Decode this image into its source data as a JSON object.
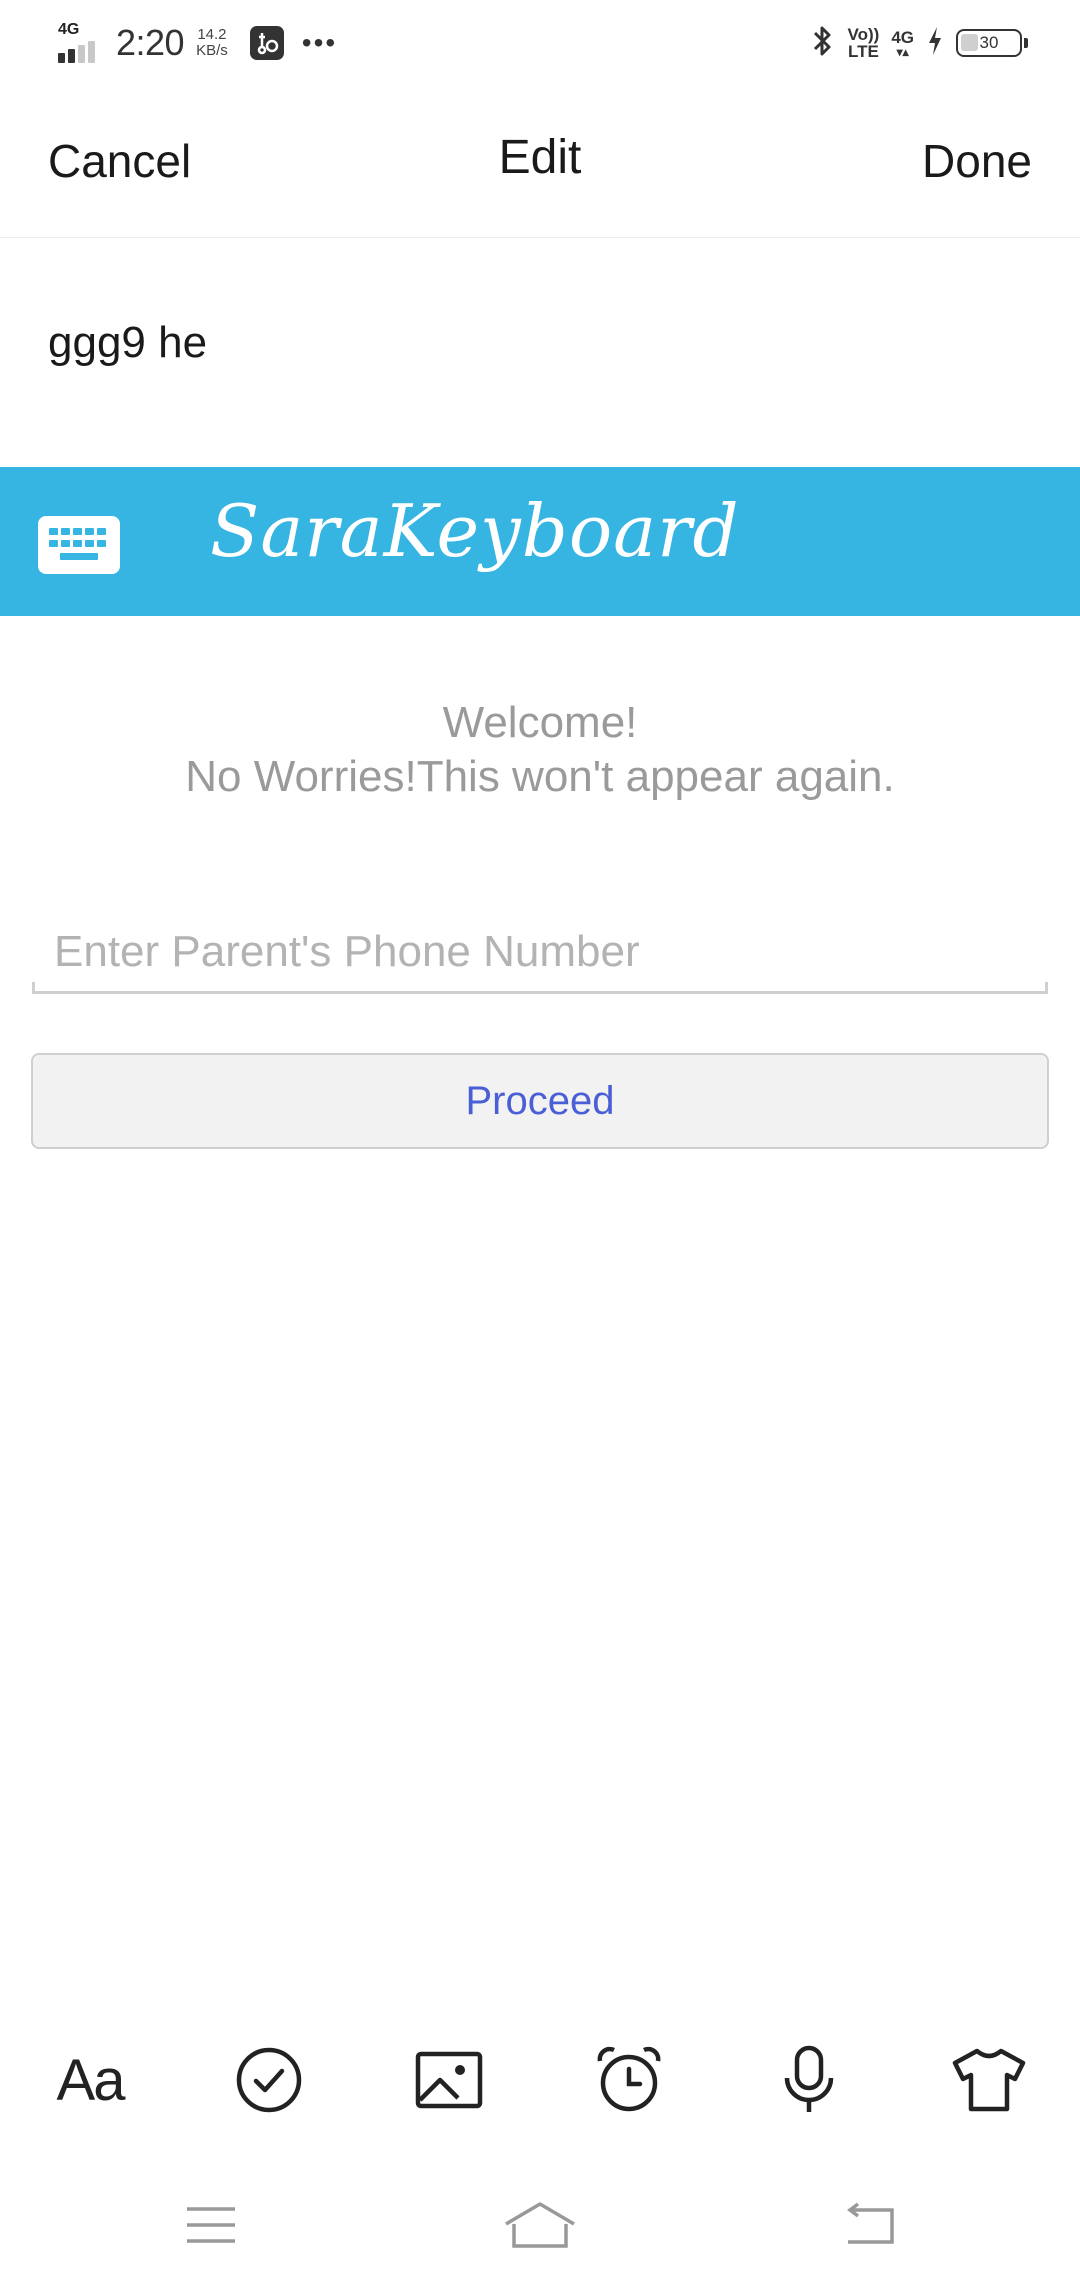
{
  "status_bar": {
    "network": "4G",
    "time": "2:20",
    "speed_value": "14.2",
    "speed_unit": "KB/s",
    "more_dots": "•••",
    "volte_top": "Vo))",
    "volte_bottom": "LTE",
    "data_network": "4G",
    "battery": "30"
  },
  "edit_bar": {
    "cancel": "Cancel",
    "title": "Edit",
    "done": "Done"
  },
  "note": {
    "text": "ggg9 he"
  },
  "keyboard_banner": {
    "brand": "SaraKeyboard",
    "color": "#36b4e2"
  },
  "welcome": {
    "line1": "Welcome!",
    "line2": "No Worries!This won't appear again."
  },
  "form": {
    "phone_placeholder": "Enter Parent's Phone Number",
    "phone_value": "",
    "proceed_label": "Proceed"
  },
  "toolbar": {
    "format_label": "Aa",
    "icons": [
      "text-format-icon",
      "checkmark-circle-icon",
      "image-icon",
      "alarm-clock-icon",
      "microphone-icon",
      "t-shirt-icon"
    ]
  },
  "navigation": {
    "icons": [
      "menu-icon",
      "home-icon",
      "back-icon"
    ]
  }
}
